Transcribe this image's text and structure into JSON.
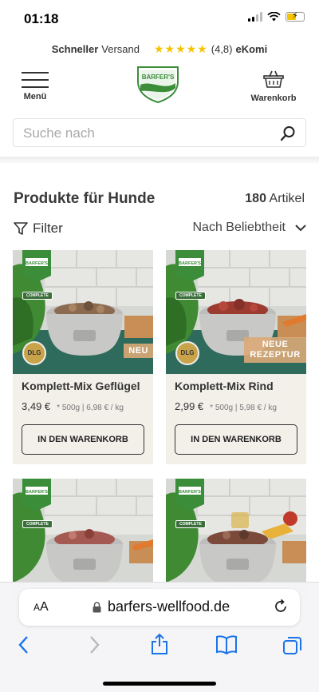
{
  "status": {
    "time": "01:18"
  },
  "trust": {
    "shipping_bold": "Schneller",
    "shipping_rest": "Versand",
    "stars": "★★★★★",
    "rating": "(4,8)",
    "provider": "eKomi"
  },
  "header": {
    "menu_label": "Menü",
    "logo_text": "BARFER'S",
    "cart_label": "Warenkorb"
  },
  "search": {
    "placeholder": "Suche nach"
  },
  "listing": {
    "title": "Produkte für Hunde",
    "count": "180",
    "count_label": "Artikel",
    "filter_label": "Filter",
    "sort_label": "Nach Beliebtheit"
  },
  "products": [
    {
      "name": "Komplett-Mix Geflügel",
      "price": "3,49 €",
      "unit": "* 500g | 6,98 € / kg",
      "badge": "NEU",
      "button": "IN DEN WARENKORB",
      "brand": "BARFER'S",
      "tag": "COMPLETE",
      "seal": "DLG"
    },
    {
      "name": "Komplett-Mix Rind",
      "price": "2,99 €",
      "unit": "* 500g | 5,98 € / kg",
      "badge": "NEUE REZEPTUR",
      "button": "IN DEN WARENKORB",
      "brand": "BARFER'S",
      "tag": "COMPLETE",
      "seal": "DLG"
    },
    {
      "brand": "BARFER'S",
      "tag": "COMPLETE"
    },
    {
      "brand": "BARFER'S",
      "tag": "COMPLETE"
    }
  ],
  "browser": {
    "aa_small": "A",
    "aa_large": "A",
    "url": "barfers-wellfood.de"
  },
  "colors": {
    "brand_green": "#3b8d3a",
    "card_bg": "#f3f0ea",
    "star": "#f5c400"
  }
}
